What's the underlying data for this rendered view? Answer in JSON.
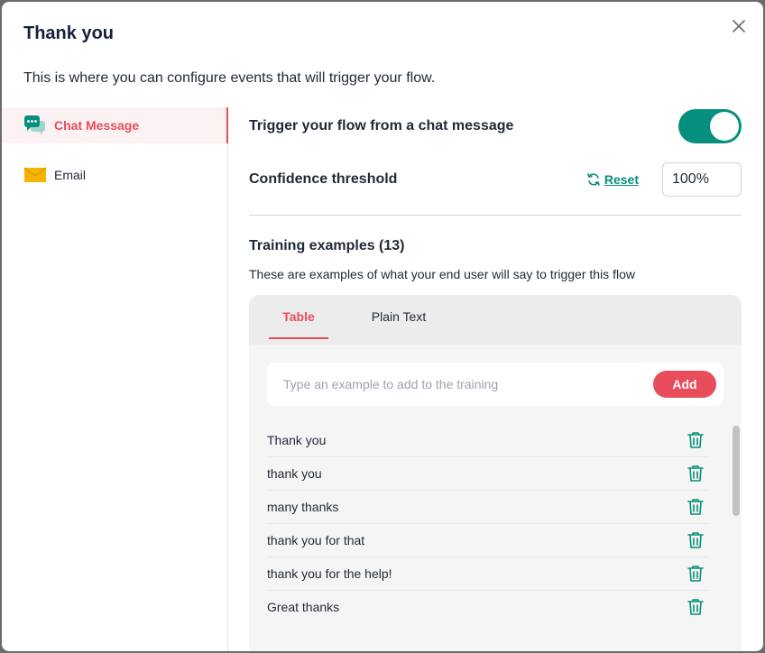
{
  "modal": {
    "title": "Thank you",
    "subtitle": "This is where you can configure events that will trigger your flow."
  },
  "sidebar": {
    "items": [
      {
        "label": "Chat Message",
        "icon": "chat-bubbles-icon",
        "active": true
      },
      {
        "label": "Email",
        "icon": "envelope-icon",
        "active": false
      }
    ]
  },
  "trigger": {
    "label": "Trigger your flow from a chat message",
    "enabled": true
  },
  "confidence": {
    "label": "Confidence threshold",
    "reset_label": "Reset",
    "value": "100%"
  },
  "training": {
    "title": "Training examples (13)",
    "description": "These are examples of what your end user will say to trigger this flow",
    "tabs": [
      {
        "label": "Table",
        "active": true
      },
      {
        "label": "Plain Text",
        "active": false
      }
    ],
    "input_placeholder": "Type an example to add to the training",
    "add_label": "Add",
    "examples": [
      "Thank you",
      "thank you",
      "many thanks",
      "thank you for that",
      "thank you for the help!",
      "Great thanks"
    ]
  },
  "colors": {
    "accent": "#e94c5b",
    "teal": "#068f7d",
    "email_icon": "#f5b400"
  }
}
